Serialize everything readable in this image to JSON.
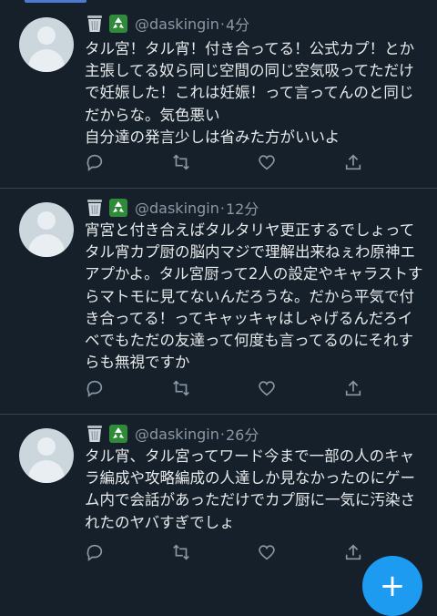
{
  "tweets": [
    {
      "handle": "@daskingin",
      "sep": "·",
      "time": "4分",
      "text": "タル宮！タル宵！付き合ってる！公式カプ！とか主張してる奴ら同じ空間の同じ空気吸ってただけで妊娠した！これは妊娠！って言ってんのと同じだからな。気色悪い\n自分達の発言少しは省みた方がいいよ"
    },
    {
      "handle": "@daskingin",
      "sep": "·",
      "time": "12分",
      "text": "宵宮と付き合えばタルタリヤ更正するでしょってタル宵カプ厨の脳内マジで理解出来ねぇわ原神エアプかよ。タル宮厨って2人の設定やキャラストすらマトモに見てないんだろうな。だから平気で付き合ってる！ってキャッキャはしゃげるんだろイベでもただの友達って何度も言ってるのにそれすらも無視ですか"
    },
    {
      "handle": "@daskingin",
      "sep": "·",
      "time": "26分",
      "text": "タル宵、タル宮ってワード今まで一部の人のキャラ編成や攻略編成の人達しか見なかったのにゲーム内で会話があっただけでカプ厨に一気に汚染されたのヤバすぎでしょ"
    }
  ],
  "icons": [
    "trash-icon",
    "recycle-icon",
    "reply-icon",
    "retweet-icon",
    "like-icon",
    "share-icon",
    "compose-icon"
  ],
  "colors": {
    "background": "#15202b",
    "text": "#e7e9ea",
    "muted": "#8b98a5",
    "accent": "#1d9bf0",
    "divider": "#38444d"
  }
}
